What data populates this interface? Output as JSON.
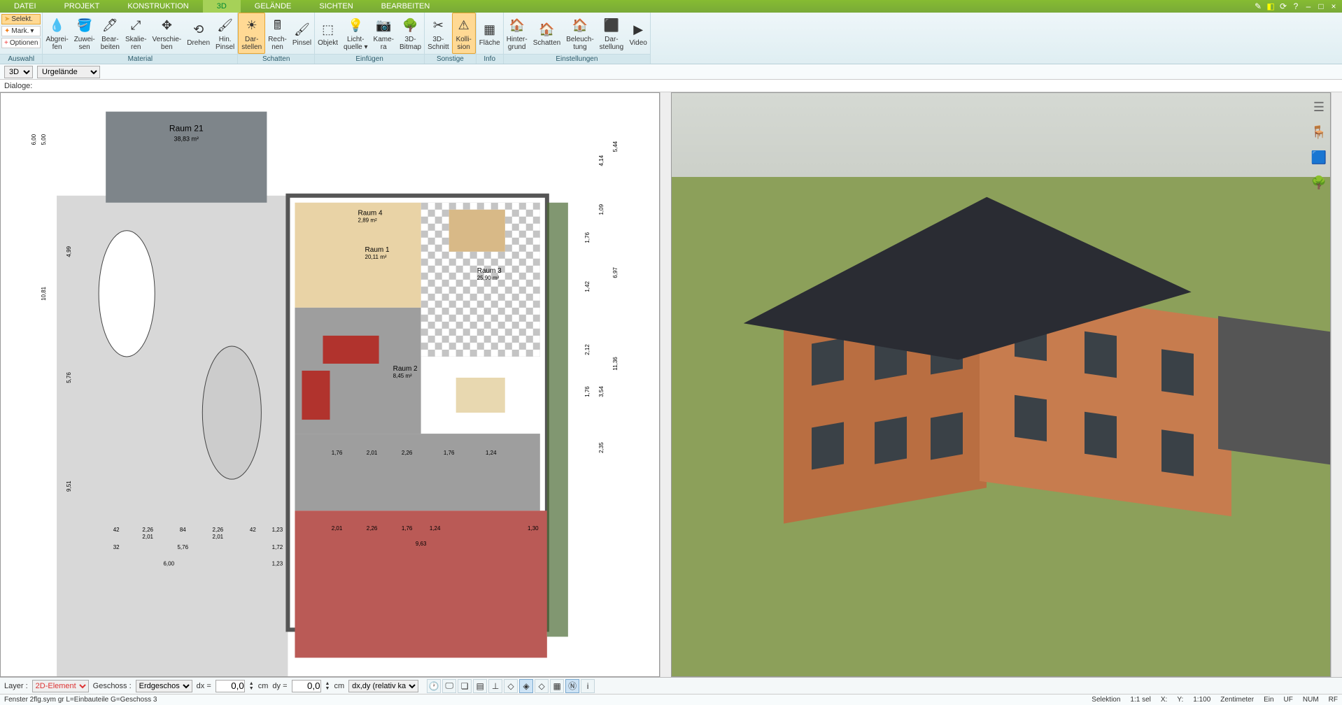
{
  "menu": {
    "items": [
      "DATEI",
      "PROJEKT",
      "KONSTRUKTION",
      "3D",
      "GELÄNDE",
      "SICHTEN",
      "BEARBEITEN"
    ],
    "active_index": 3
  },
  "ribbon": {
    "auswahl": {
      "select": "Selekt.",
      "mark": "Mark.",
      "options": "Optionen",
      "label": "Auswahl"
    },
    "material": {
      "buttons": [
        {
          "l1": "Abgrei-",
          "l2": "fen"
        },
        {
          "l1": "Zuwei-",
          "l2": "sen"
        },
        {
          "l1": "Bear-",
          "l2": "beiten"
        },
        {
          "l1": "Skalie-",
          "l2": "ren"
        },
        {
          "l1": "Verschie-",
          "l2": "ben"
        },
        {
          "l1": "Drehen",
          "l2": ""
        },
        {
          "l1": "Hin.",
          "l2": "Pinsel"
        }
      ],
      "label": "Material"
    },
    "schatten": {
      "buttons": [
        {
          "l1": "Dar-",
          "l2": "stellen",
          "hl": true
        },
        {
          "l1": "Rech-",
          "l2": "nen"
        },
        {
          "l1": "Pinsel",
          "l2": ""
        }
      ],
      "label": "Schatten"
    },
    "einfuegen": {
      "buttons": [
        {
          "l1": "Objekt",
          "l2": ""
        },
        {
          "l1": "Licht-",
          "l2": "quelle ▾"
        },
        {
          "l1": "Kame-",
          "l2": "ra"
        },
        {
          "l1": "3D-",
          "l2": "Bitmap"
        }
      ],
      "label": "Einfügen"
    },
    "sonstige": {
      "buttons": [
        {
          "l1": "3D-",
          "l2": "Schnitt"
        },
        {
          "l1": "Kolli-",
          "l2": "sion",
          "hl": true
        }
      ],
      "label": "Sonstige"
    },
    "info": {
      "buttons": [
        {
          "l1": "Fläche",
          "l2": ""
        }
      ],
      "label": "Info"
    },
    "einstellungen": {
      "buttons": [
        {
          "l1": "Hinter-",
          "l2": "grund"
        },
        {
          "l1": "Schatten",
          "l2": ""
        },
        {
          "l1": "Beleuch-",
          "l2": "tung"
        },
        {
          "l1": "Dar-",
          "l2": "stellung"
        },
        {
          "l1": "Video",
          "l2": ""
        }
      ],
      "label": "Einstellungen"
    }
  },
  "drop": {
    "mode": "3D",
    "layer": "Urgelände"
  },
  "dialoge_label": "Dialoge:",
  "rooms": {
    "r21": {
      "name": "Raum 21",
      "area": "38,83 m²"
    },
    "r4": {
      "name": "Raum 4",
      "area": "2,89 m²"
    },
    "r1": {
      "name": "Raum 1",
      "area": "20,11 m²"
    },
    "r3": {
      "name": "Raum 3",
      "area": "25,90 m²"
    },
    "r2": {
      "name": "Raum 2",
      "area": "8,45 m²"
    }
  },
  "dims": {
    "left_outer": [
      "6,00",
      "5,00",
      "4,99",
      "10,81",
      "5,76",
      "9,51"
    ],
    "bot_row": [
      "42",
      "2,26",
      "2,01",
      "84",
      "2,26",
      "2,01",
      "42",
      "1,23"
    ],
    "bot_row2": [
      "32",
      "5,76",
      "1,72"
    ],
    "bot_row3": [
      "6,00",
      "1,23"
    ],
    "right_outer": [
      "5,44",
      "4,14",
      "1,09",
      "1,76",
      "1,42",
      "6,97",
      "2,12",
      "11,36",
      "1,76",
      "3,54",
      "2,35"
    ],
    "inner": [
      "2,01",
      "2,26",
      "1,76",
      "1,24",
      "9,63",
      "1,76",
      "2,01",
      "2,26",
      "1,76",
      "1,24",
      "1,30"
    ]
  },
  "bottombar": {
    "layer_label": "Layer :",
    "layer_value": "2D-Element",
    "geschoss_label": "Geschoss :",
    "geschoss_value": "Erdgeschos",
    "dx_label": "dx =",
    "dx_value": "0,0",
    "dx_unit": "cm",
    "dy_label": "dy =",
    "dy_value": "0,0",
    "dy_unit": "cm",
    "rel": "dx,dy (relativ ka"
  },
  "status": {
    "left": "Fenster 2flg.sym gr L=Einbauteile G=Geschoss 3",
    "sel": "Selektion",
    "scale": "1:1 sel",
    "x": "X:",
    "y": "Y:",
    "scale2": "1:100",
    "unit": "Zentimeter",
    "ein": "Ein",
    "uf": "UF",
    "num": "NUM",
    "rf": "RF"
  }
}
